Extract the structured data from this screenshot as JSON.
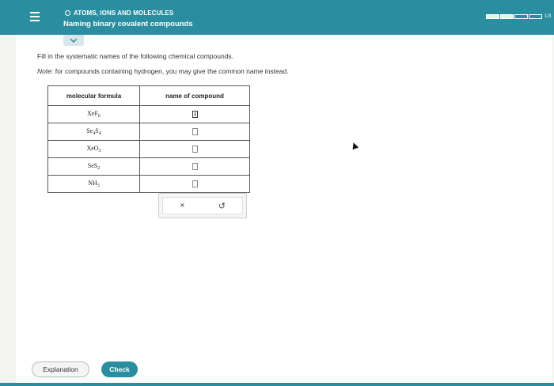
{
  "header": {
    "topic": "ATOMS, IONS AND MOLECULES",
    "subtitle": "Naming binary covalent compounds",
    "progress_label": "1/3",
    "progress_filled": 2,
    "progress_total": 4,
    "color_accent": "#2a8ea0"
  },
  "main": {
    "instruction": "Fill in the systematic names of the following chemical compounds.",
    "note_label": "Note:",
    "note_text": "for compounds containing hydrogen, you may give the common name instead."
  },
  "table": {
    "headers": [
      "molecular formula",
      "name of compound"
    ],
    "rows": [
      {
        "base": "XeF",
        "sub": "6",
        "base2": "",
        "sub2": ""
      },
      {
        "base": "Se",
        "sub": "4",
        "base2": "S",
        "sub2": "4"
      },
      {
        "base": "XeO",
        "sub": "3",
        "base2": "",
        "sub2": ""
      },
      {
        "base": "SeS",
        "sub": "2",
        "base2": "",
        "sub2": ""
      },
      {
        "base": "NH",
        "sub": "3",
        "base2": "",
        "sub2": ""
      }
    ]
  },
  "tools": {
    "clear_icon": "x-icon",
    "clear_symbol": "×",
    "undo_icon": "undo-icon",
    "undo_symbol": "↺"
  },
  "footer": {
    "explanation_label": "Explanation",
    "check_label": "Check"
  }
}
